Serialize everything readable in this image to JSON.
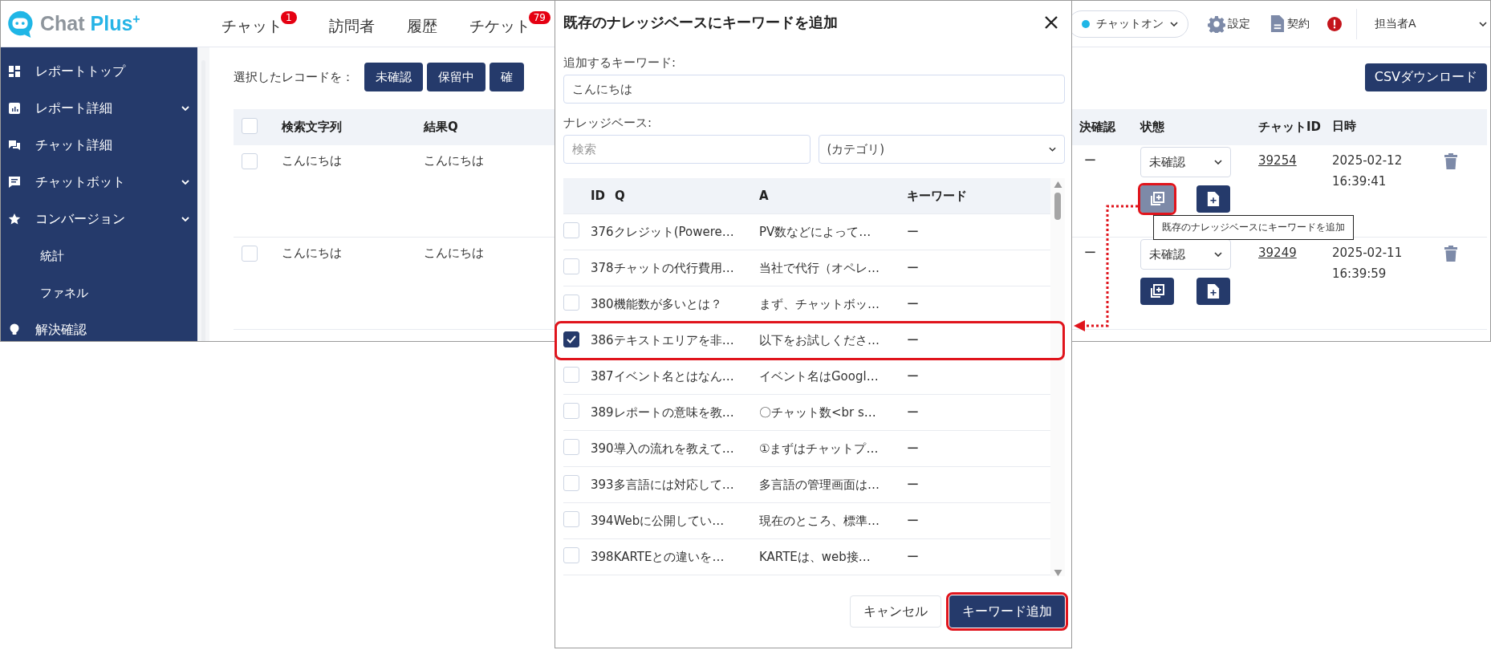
{
  "app": {
    "logo": {
      "word1": "Chat",
      "word2": "Plus",
      "mark": "+"
    },
    "nav": [
      {
        "label": "チャット",
        "badge": "1"
      },
      {
        "label": "訪問者"
      },
      {
        "label": "履歴"
      },
      {
        "label": "チケット",
        "badge": "79"
      }
    ],
    "status_menu": "チャットオン",
    "header_links": [
      {
        "kind": "gear",
        "label": "設定"
      },
      {
        "kind": "document",
        "label": "契約"
      }
    ],
    "user": "担当者A",
    "sidebar": [
      {
        "kind": "dashboard",
        "label": "レポートトップ"
      },
      {
        "kind": "chart",
        "label": "レポート詳細",
        "submenu": true
      },
      {
        "kind": "chats",
        "label": "チャット詳細"
      },
      {
        "kind": "message",
        "label": "チャットボット",
        "submenu": true
      },
      {
        "kind": "star",
        "label": "コンバージョン",
        "submenu": true,
        "children": [
          {
            "label": "統計"
          },
          {
            "label": "ファネル"
          }
        ]
      },
      {
        "kind": "bulb",
        "label": "解決確認"
      }
    ],
    "bulk_label": "選択したレコードを：",
    "bulk_buttons": [
      "未確認",
      "保留中",
      "確"
    ],
    "csv_button": "CSVダウンロード",
    "select_all_checked": false,
    "columns_left": [
      "検索文字列",
      "結果Q"
    ],
    "columns_right": [
      "決確認",
      "状態",
      "チャットID",
      "日時"
    ],
    "rows": [
      {
        "checked": false,
        "search": "こんにちは",
        "result_q": "こんにちは",
        "resolved": "ー",
        "status": "未確認",
        "chat_id": "39254",
        "date": "2025-02-12",
        "time": "16:39:41",
        "highlighted": true
      },
      {
        "checked": false,
        "search": "こんにちは",
        "result_q": "こんにちは",
        "resolved": "ー",
        "status": "未確認",
        "chat_id": "39249",
        "date": "2025-02-11",
        "time": "16:39:59",
        "highlighted": false
      }
    ],
    "tooltip": "既存のナレッジベースにキーワードを追加"
  },
  "dialog": {
    "title": "既存のナレッジベースにキーワードを追加",
    "keyword_label": "追加するキーワード:",
    "keyword_value": "こんにちは",
    "kb_label": "ナレッジベース:",
    "search_placeholder": "検索",
    "category": "(カテゴリ)",
    "columns": [
      "ID",
      "Q",
      "A",
      "キーワード"
    ],
    "items": [
      {
        "id": "376",
        "q": "クレジット(Powere…",
        "a": "PV数などによって…",
        "keyword": "ー",
        "checked": false,
        "highlighted": false
      },
      {
        "id": "378",
        "q": "チャットの代行費用…",
        "a": "当社で代行（オペレ…",
        "keyword": "ー",
        "checked": false,
        "highlighted": false
      },
      {
        "id": "380",
        "q": "機能数が多いとは？",
        "a": "まず、チャットボッ…",
        "keyword": "ー",
        "checked": false,
        "highlighted": false
      },
      {
        "id": "386",
        "q": "テキストエリアを非…",
        "a": "以下をお試しくださ…",
        "keyword": "ー",
        "checked": true,
        "highlighted": true
      },
      {
        "id": "387",
        "q": "イベント名とはなん…",
        "a": "イベント名はGoogl…",
        "keyword": "ー",
        "checked": false,
        "highlighted": false
      },
      {
        "id": "389",
        "q": "レポートの意味を教…",
        "a": "〇チャット数<br s…",
        "keyword": "ー",
        "checked": false,
        "highlighted": false
      },
      {
        "id": "390",
        "q": "導入の流れを教えて…",
        "a": "①まずはチャットプ…",
        "keyword": "ー",
        "checked": false,
        "highlighted": false
      },
      {
        "id": "393",
        "q": "多言語には対応して…",
        "a": "多言語の管理画面は…",
        "keyword": "ー",
        "checked": false,
        "highlighted": false
      },
      {
        "id": "394",
        "q": "Webに公開してい…",
        "a": "現在のところ、標準…",
        "keyword": "ー",
        "checked": false,
        "highlighted": false
      },
      {
        "id": "398",
        "q": "KARTEとの違いを…",
        "a": "KARTEは、web接…",
        "keyword": "ー",
        "checked": false,
        "highlighted": false
      }
    ],
    "buttons": [
      {
        "label": "キャンセル",
        "kind": "secondary",
        "highlighted": false
      },
      {
        "label": "キーワード追加",
        "kind": "primary",
        "highlighted": true
      }
    ]
  }
}
